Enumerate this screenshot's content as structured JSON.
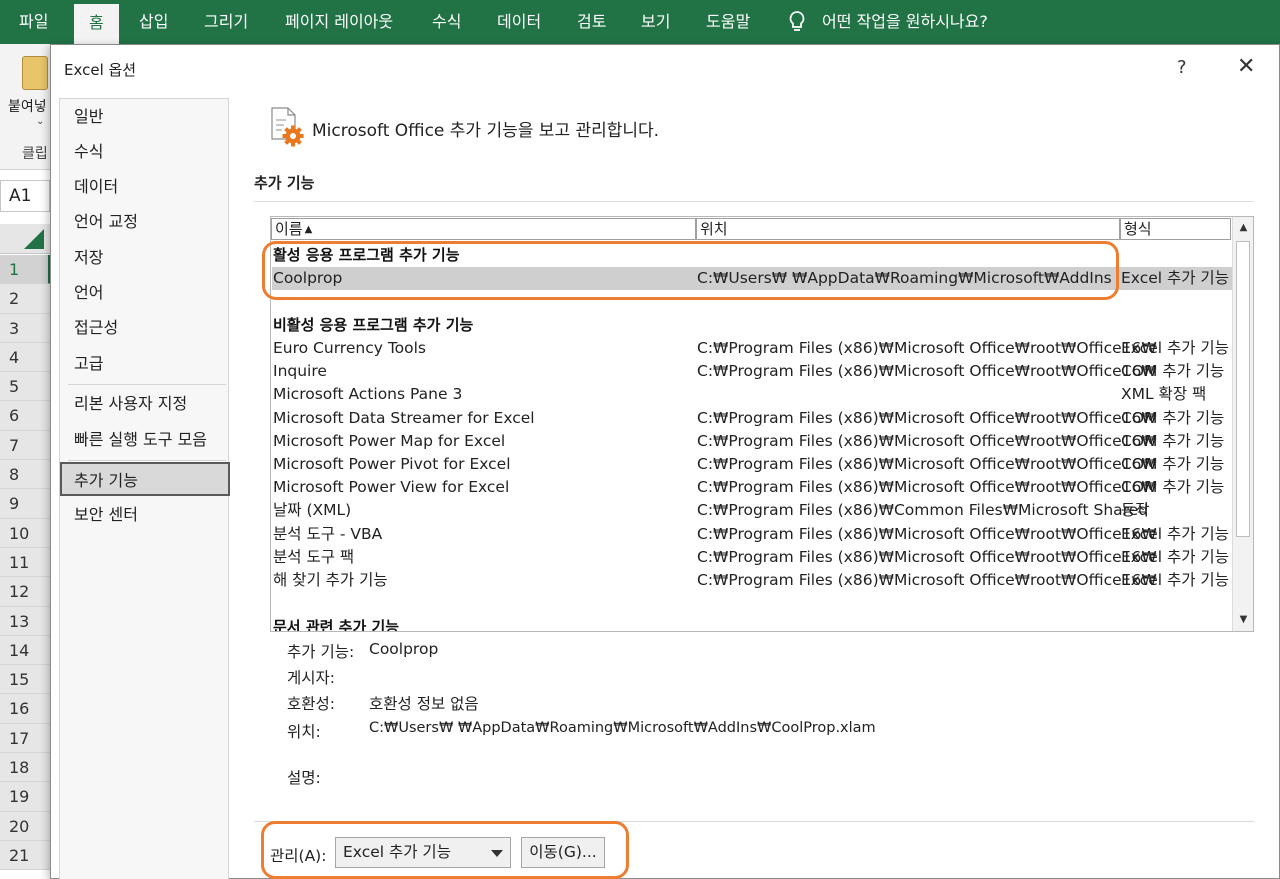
{
  "ribbon": {
    "tabs": [
      "파일",
      "홈",
      "삽입",
      "그리기",
      "페이지 레이아웃",
      "수식",
      "데이터",
      "검토",
      "보기",
      "도움말"
    ],
    "active_tab": "홈",
    "tell_me": "어떤 작업을 원하시나요?",
    "paste_label": "붙여넣",
    "clipboard_label": "클립",
    "name_box": "A1",
    "row_numbers": [
      "1",
      "2",
      "3",
      "4",
      "5",
      "6",
      "7",
      "8",
      "9",
      "10",
      "11",
      "12",
      "13",
      "14",
      "15",
      "16",
      "17",
      "18",
      "19",
      "20",
      "21"
    ]
  },
  "dialog": {
    "title": "Excel 옵션",
    "help": "?",
    "close": "✕",
    "sidebar": [
      "일반",
      "수식",
      "데이터",
      "언어 교정",
      "저장",
      "언어",
      "접근성",
      "고급",
      "리본 사용자 지정",
      "빠른 실행 도구 모음",
      "추가 기능",
      "보안 센터"
    ],
    "active_sidebar": "추가 기능",
    "header": "Microsoft Office 추가 기능을 보고 관리합니다.",
    "section_title": "추가 기능",
    "columns": {
      "name": "이름",
      "location": "위치",
      "type": "형식"
    },
    "groups": [
      {
        "title": "활성 응용 프로그램 추가 기능",
        "rows": [
          {
            "name": "Coolprop",
            "location": "C:₩Users₩        ₩AppData₩Roaming₩Microsoft₩AddIns",
            "type": "Excel 추가 기능",
            "selected": true
          }
        ]
      },
      {
        "title": "비활성 응용 프로그램 추가 기능",
        "rows": [
          {
            "name": "Euro Currency Tools",
            "location": "C:₩Program Files (x86)₩Microsoft Office₩root₩Office16₩",
            "type": "Excel 추가 기능"
          },
          {
            "name": "Inquire",
            "location": "C:₩Program Files (x86)₩Microsoft Office₩root₩Office16₩",
            "type": "COM 추가 기능"
          },
          {
            "name": "Microsoft Actions Pane 3",
            "location": "",
            "type": "XML 확장 팩"
          },
          {
            "name": "Microsoft Data Streamer for Excel",
            "location": "C:₩Program Files (x86)₩Microsoft Office₩root₩Office16₩",
            "type": "COM 추가 기능"
          },
          {
            "name": "Microsoft Power Map for Excel",
            "location": "C:₩Program Files (x86)₩Microsoft Office₩root₩Office16₩",
            "type": "COM 추가 기능"
          },
          {
            "name": "Microsoft Power Pivot for Excel",
            "location": "C:₩Program Files (x86)₩Microsoft Office₩root₩Office16₩",
            "type": "COM 추가 기능"
          },
          {
            "name": "Microsoft Power View for Excel",
            "location": "C:₩Program Files (x86)₩Microsoft Office₩root₩Office16₩",
            "type": "COM 추가 기능"
          },
          {
            "name": "날짜 (XML)",
            "location": "C:₩Program Files (x86)₩Common Files₩Microsoft Shared",
            "type": "동작"
          },
          {
            "name": "분석 도구 - VBA",
            "location": "C:₩Program Files (x86)₩Microsoft Office₩root₩Office16₩",
            "type": "Excel 추가 기능"
          },
          {
            "name": "분석 도구 팩",
            "location": "C:₩Program Files (x86)₩Microsoft Office₩root₩Office16₩",
            "type": "Excel 추가 기능"
          },
          {
            "name": "해 찾기 추가 기능",
            "location": "C:₩Program Files (x86)₩Microsoft Office₩root₩Office16₩",
            "type": "Excel 추가 기능"
          }
        ]
      },
      {
        "title": "문서 관련 추가 기능",
        "rows": []
      }
    ],
    "details": {
      "addin_label": "추가 기능:",
      "addin_value": "Coolprop",
      "publisher_label": "게시자:",
      "publisher_value": "",
      "compat_label": "호환성:",
      "compat_value": "호환성 정보 없음",
      "location_label": "위치:",
      "location_value": "C:₩Users₩        ₩AppData₩Roaming₩Microsoft₩AddIns₩CoolProp.xlam",
      "desc_label": "설명:",
      "desc_value": ""
    },
    "manage": {
      "label": "관리(A):",
      "selected": "Excel 추가 기능",
      "go_label": "이동(G)..."
    }
  },
  "colors": {
    "excel_green": "#217346",
    "highlight": "#ed7d31",
    "selected_row": "#cfcfcf"
  },
  "icons": {
    "tell_me": "lightbulb-icon",
    "header": "addins-gear-icon",
    "sort": "sort-up-icon"
  }
}
